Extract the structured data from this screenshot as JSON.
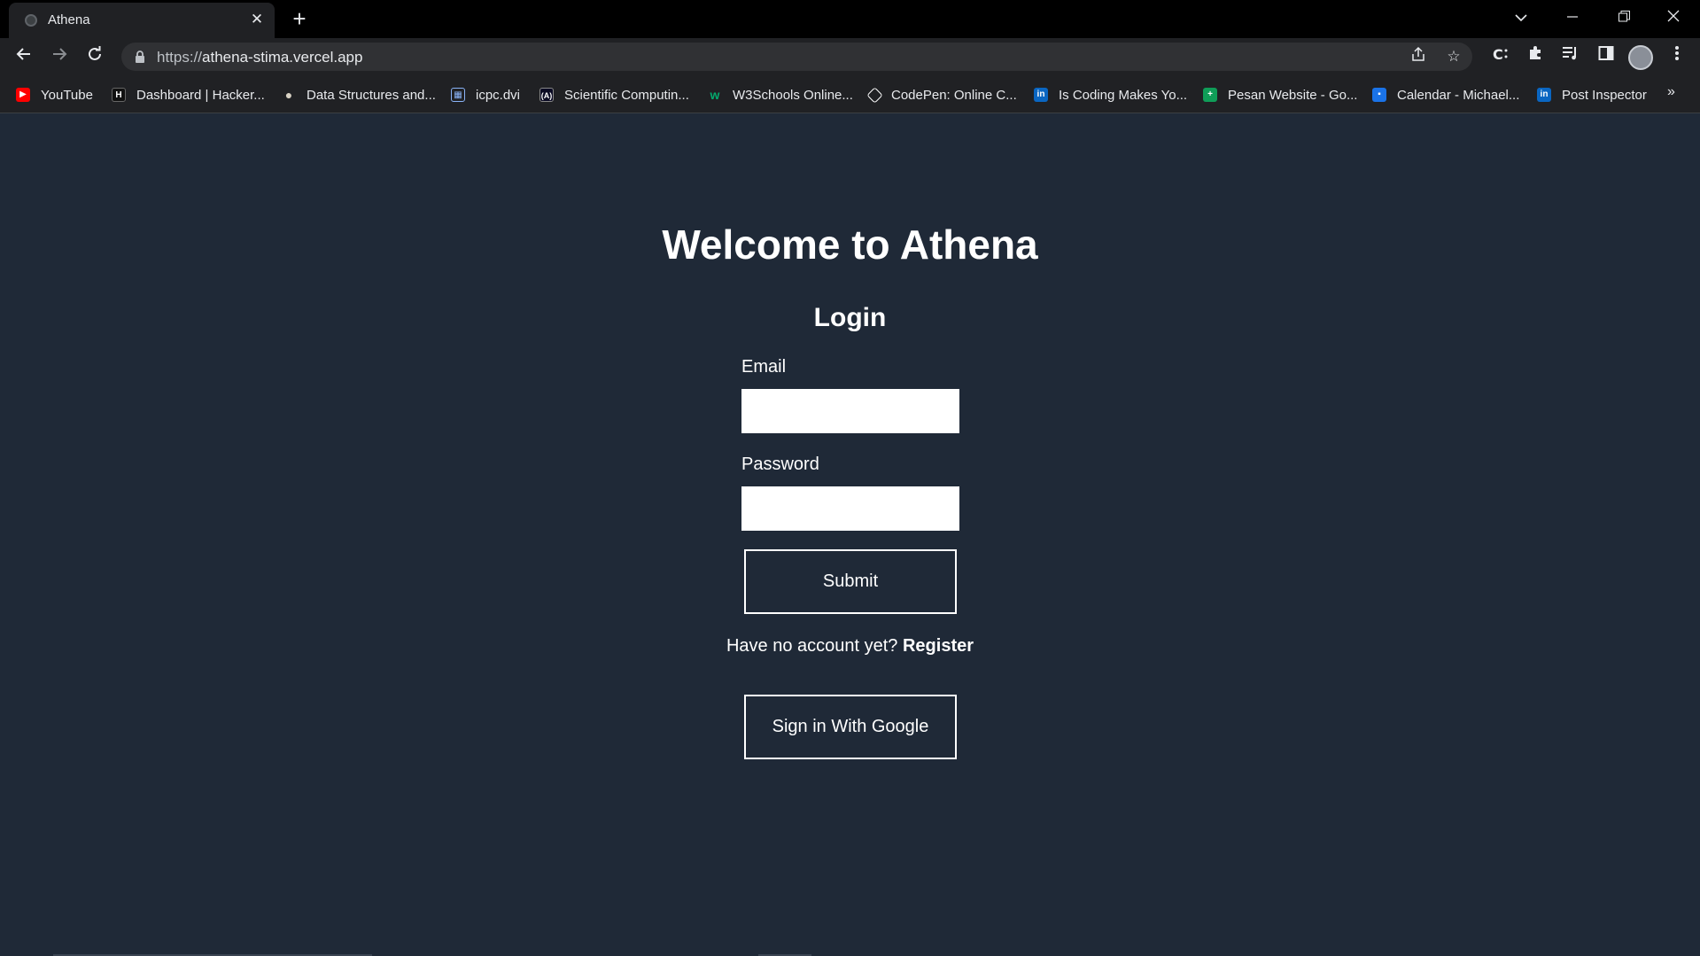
{
  "browser": {
    "tab_title": "Athena",
    "url_prefix": "https://",
    "url_host": "athena-stima.vercel.app",
    "bookmarks": [
      {
        "label": "YouTube",
        "icon": "youtube-icon",
        "color": "#ff0000"
      },
      {
        "label": "Dashboard | Hacker...",
        "icon": "hackerrank-icon",
        "color": "#111111"
      },
      {
        "label": "Data Structures and...",
        "icon": "bulb-icon",
        "color": "#d8d2c4"
      },
      {
        "label": "icpc.dvi",
        "icon": "grid-icon",
        "color": "#8ab4f8"
      },
      {
        "label": "Scientific Computin...",
        "icon": "freecodecamp-icon",
        "color": "#0a0a23"
      },
      {
        "label": "W3Schools Online...",
        "icon": "w3schools-icon",
        "color": "#04aa6d"
      },
      {
        "label": "CodePen: Online C...",
        "icon": "codepen-icon",
        "color": "#ffffff"
      },
      {
        "label": "Is Coding Makes Yo...",
        "icon": "linkedin-icon",
        "color": "#0a66c2"
      },
      {
        "label": "Pesan Website - Go...",
        "icon": "google-sheets-icon",
        "color": "#0f9d58"
      },
      {
        "label": "Calendar - Michael...",
        "icon": "calendar-icon",
        "color": "#1a73e8"
      },
      {
        "label": "Post Inspector",
        "icon": "linkedin-icon",
        "color": "#0a66c2"
      }
    ],
    "more_bookmarks": "»"
  },
  "page": {
    "heading": "Welcome to Athena",
    "login_title": "Login",
    "email_label": "Email",
    "email_value": "",
    "password_label": "Password",
    "password_value": "",
    "submit_label": "Submit",
    "register_prompt": "Have no account yet? ",
    "register_link": "Register",
    "google_label": "Sign in With Google",
    "background": "#1f2937"
  }
}
